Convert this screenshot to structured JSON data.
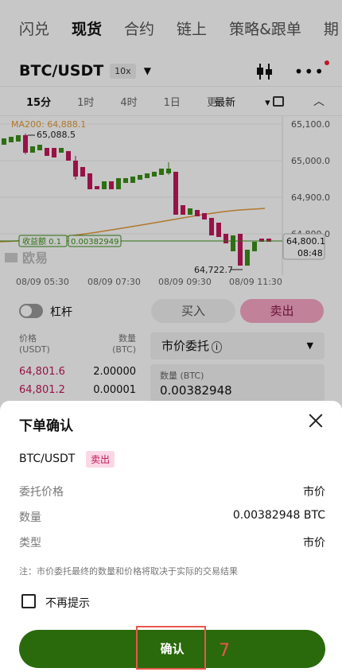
{
  "nav": {
    "tabs": [
      "闪兑",
      "现货",
      "合约",
      "链上",
      "策略&跟单",
      "期"
    ],
    "active_index": 1
  },
  "pair_bar": {
    "pair": "BTC/USDT",
    "leverage": "10x"
  },
  "timeframes": {
    "items": [
      "15分",
      "1时",
      "4时",
      "1日",
      "更"
    ],
    "active_index": 0,
    "latest_label": "最新"
  },
  "chart": {
    "ma_label": "MA200: 64,888.1",
    "high_label": "65,088.5",
    "low_label": "64,722.7",
    "y_ticks": [
      "65,100.0",
      "65,000.0",
      "64,900.0",
      "64,800.0"
    ],
    "x_ticks": [
      "08/09 05:30",
      "08/09 07:30",
      "08/09 09:30",
      "08/09 11:30"
    ],
    "pnl_label": "收益额 0.1",
    "pnl_value": "0.00382949",
    "last_price": "64,800.1",
    "countdown": "08:48",
    "watermark": "欧易",
    "colors": {
      "up": "#3a8f18",
      "down": "#c2185b",
      "ma": "#e39a3b"
    }
  },
  "trade": {
    "leverage_label": "杠杆",
    "buy_label": "买入",
    "sell_label": "卖出",
    "ob_price_header": "价格\n(USDT)",
    "ob_qty_header": "数量\n(BTC)",
    "orderbook": [
      {
        "price": "64,801.6",
        "qty": "2.00000"
      },
      {
        "price": "64,801.2",
        "qty": "0.00001"
      }
    ],
    "order_type": "市价委托",
    "qty_label": "数量 (BTC)",
    "qty_value": "0.00382948"
  },
  "sheet": {
    "title": "下单确认",
    "pair": "BTC/USDT",
    "side": "卖出",
    "rows": [
      {
        "key": "委托价格",
        "value": "市价"
      },
      {
        "key": "数量",
        "value": "0.00382948 BTC"
      },
      {
        "key": "类型",
        "value": "市价"
      }
    ],
    "note": "注：市价委托最终的数量和价格将取决于实际的交易结果",
    "checkbox_label": "不再提示",
    "confirm_label": "确认",
    "step_number": "7",
    "accent": "#2a6a0d"
  }
}
